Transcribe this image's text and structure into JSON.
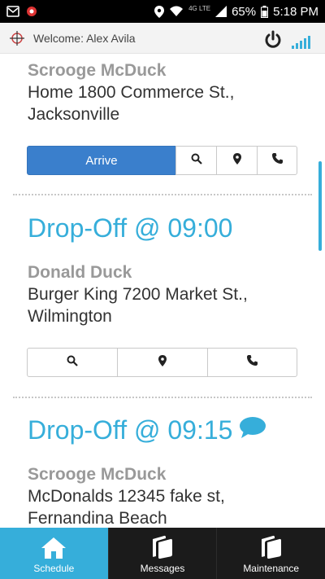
{
  "status_bar": {
    "battery": "65%",
    "time": "5:18 PM",
    "network_small": "4G LTE",
    "icons": [
      "mail-icon",
      "record-icon",
      "location-icon",
      "wifi-icon",
      "signal-icon",
      "battery-icon"
    ]
  },
  "header": {
    "welcome": "Welcome: Alex Avila",
    "icons": [
      "crosshair-icon",
      "power-icon",
      "signal-strength-icon"
    ]
  },
  "stops": [
    {
      "heading": "",
      "name": "Scrooge McDuck",
      "address_line1": "Home 1800 Commerce St.,",
      "address_line2": "Jacksonville",
      "primary_button": "Arrive"
    },
    {
      "heading": "Drop-Off @ 09:00",
      "name": "Donald Duck",
      "address_line1": "Burger King 7200 Market St.,",
      "address_line2": "Wilmington"
    },
    {
      "heading": "Drop-Off @ 09:15",
      "name": "Scrooge McDuck",
      "address_line1": "McDonalds 12345 fake st,",
      "address_line2": "Fernandina Beach"
    }
  ],
  "tabs": [
    {
      "label": "Schedule",
      "icon": "home-icon",
      "active": true
    },
    {
      "label": "Messages",
      "icon": "cards-icon",
      "active": false
    },
    {
      "label": "Maintenance",
      "icon": "cards-icon",
      "active": false
    }
  ],
  "colors": {
    "accent": "#36aeda",
    "primary_button": "#3a7fcc",
    "name_gray": "#999999"
  }
}
